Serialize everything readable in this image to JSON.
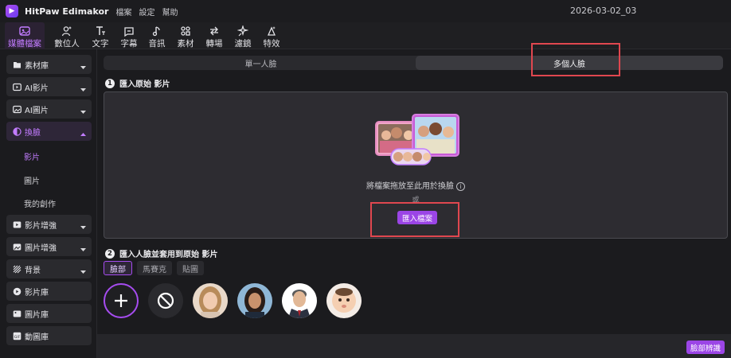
{
  "app": {
    "title": "HitPaw Edimakor",
    "project_name": "2026-03-02_03"
  },
  "menu": [
    "檔案",
    "設定",
    "幫助"
  ],
  "toolbar": [
    {
      "label": "媒體檔案",
      "icon": "media-icon",
      "active": true
    },
    {
      "label": "數位人",
      "icon": "avatar-icon",
      "active": false
    },
    {
      "label": "文字",
      "icon": "text-icon",
      "active": false
    },
    {
      "label": "字幕",
      "icon": "subtitle-icon",
      "active": false
    },
    {
      "label": "音訊",
      "icon": "music-icon",
      "active": false
    },
    {
      "label": "素材",
      "icon": "elements-icon",
      "active": false
    },
    {
      "label": "轉場",
      "icon": "transition-icon",
      "active": false
    },
    {
      "label": "濾鏡",
      "icon": "filter-icon",
      "active": false
    },
    {
      "label": "特效",
      "icon": "effects-icon",
      "active": false
    }
  ],
  "sidebar": {
    "items": [
      {
        "label": "素材庫",
        "icon": "folder-icon",
        "has_chevron": true
      },
      {
        "label": "AI影片",
        "icon": "ai-video-icon",
        "has_chevron": true
      },
      {
        "label": "AI圖片",
        "icon": "ai-image-icon",
        "has_chevron": true
      },
      {
        "label": "換臉",
        "icon": "face-swap-icon",
        "has_chevron": true,
        "active": true
      },
      {
        "label": "影片增強",
        "icon": "video-enhance-icon",
        "has_chevron": true
      },
      {
        "label": "圖片增強",
        "icon": "image-enhance-icon",
        "has_chevron": true
      },
      {
        "label": "背景",
        "icon": "background-icon",
        "has_chevron": true
      },
      {
        "label": "影片庫",
        "icon": "video-library-icon",
        "has_chevron": false
      },
      {
        "label": "圖片庫",
        "icon": "image-library-icon",
        "has_chevron": false
      },
      {
        "label": "動圖庫",
        "icon": "gif-icon",
        "has_chevron": false
      }
    ],
    "sub_items": [
      {
        "label": "影片",
        "active": true
      },
      {
        "label": "圖片",
        "active": false
      },
      {
        "label": "我的創作",
        "active": false
      }
    ]
  },
  "main": {
    "mode_tabs": [
      {
        "label": "單一人臉",
        "selected": false
      },
      {
        "label": "多個人臉",
        "selected": true
      }
    ],
    "step1": {
      "num": "1",
      "title": "匯入原始 影片"
    },
    "dropzone": {
      "text": "將檔案拖放至此用於換臉",
      "info": "i",
      "or": "或",
      "button": "匯入檔案"
    },
    "step2": {
      "num": "2",
      "title": "匯入人臉並套用到原始 影片"
    },
    "face_tabs": [
      {
        "label": "臉部",
        "selected": true
      },
      {
        "label": "馬賽克",
        "selected": false
      },
      {
        "label": "貼圖",
        "selected": false
      }
    ],
    "face_rec_button": "臉部辨識"
  },
  "colors": {
    "accent": "#9b45e6",
    "highlight": "#e0474f",
    "background": "#1b1b1e"
  }
}
